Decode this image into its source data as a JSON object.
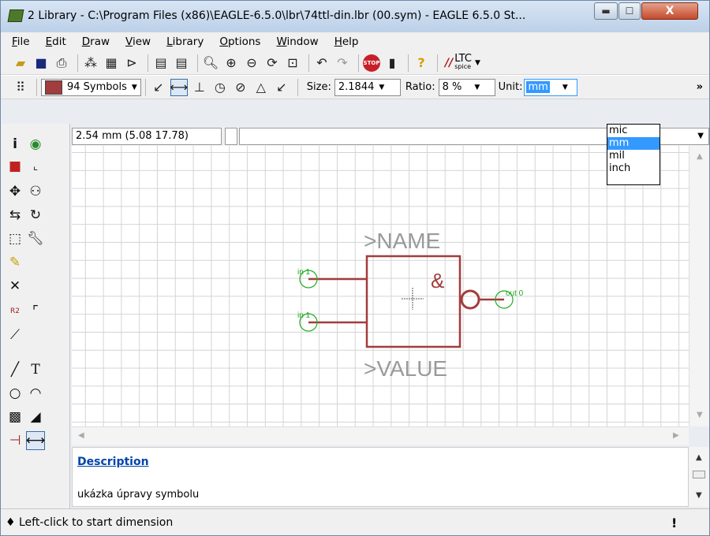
{
  "window": {
    "title": "2 Library - C:\\Program Files (x86)\\EAGLE-6.5.0\\lbr\\74ttl-din.lbr (00.sym) - EAGLE 6.5.0 St...",
    "min": "▬",
    "max": "☐",
    "close": "X"
  },
  "menu": [
    "File",
    "Edit",
    "Draw",
    "View",
    "Library",
    "Options",
    "Window",
    "Help"
  ],
  "toolbar2": {
    "layer_combo": "94 Symbols",
    "size_label": "Size:",
    "size_value": "2.1844",
    "ratio_label": "Ratio:",
    "ratio_value": "8 %",
    "unit_label": "Unit:",
    "unit_value": "mm",
    "overflow": "»"
  },
  "unit_options": [
    "mic",
    "mm",
    "mil",
    "inch"
  ],
  "unit_selected": "mm",
  "coord": "2.54 mm (5.08 17.78)",
  "symbol": {
    "name_text": ">NAME",
    "value_text": ">VALUE",
    "gate_label": "&",
    "pin_in_top": "in 1",
    "pin_in_bottom": "in 1",
    "pin_out": "out 0"
  },
  "description": {
    "title": "Description",
    "text": "ukázka úpravy symbolu"
  },
  "status": {
    "text": "♦ Left-click to start dimension",
    "icon": "!"
  },
  "ltc": {
    "main": "LTC",
    "sub": "spice"
  },
  "colors": {
    "symbol_line": "#a33c3c",
    "pin_green": "#22aa22",
    "text_gray": "#9a9a9a"
  }
}
